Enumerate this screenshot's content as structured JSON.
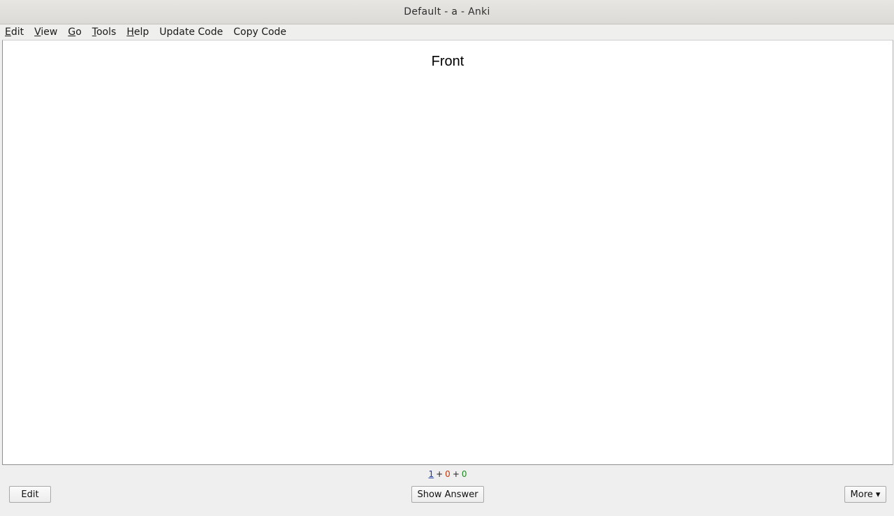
{
  "window": {
    "title": "Default - a - Anki"
  },
  "menu": {
    "items": [
      {
        "id": "edit",
        "accel": "E",
        "rest": "dit"
      },
      {
        "id": "view",
        "accel": "V",
        "rest": "iew"
      },
      {
        "id": "go",
        "accel": "G",
        "rest": "o"
      },
      {
        "id": "tools",
        "accel": "T",
        "rest": "ools"
      },
      {
        "id": "help",
        "accel": "H",
        "rest": "elp"
      }
    ],
    "update_code": "Update Code",
    "copy_code": "Copy Code"
  },
  "card": {
    "front_text": "Front"
  },
  "counts": {
    "new": "1",
    "learning": "0",
    "review": "0",
    "separator": "+",
    "colors": {
      "new": "#1c3aa6",
      "learning": "#c0390b",
      "review": "#1e8a1e"
    }
  },
  "bottom": {
    "edit_label": "Edit",
    "show_answer_label": "Show Answer",
    "more_label": "More ▾"
  }
}
